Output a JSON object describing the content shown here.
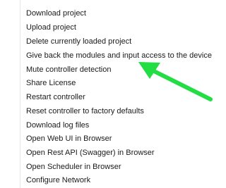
{
  "context_menu": {
    "items": [
      {
        "label": "Download project"
      },
      {
        "label": "Upload project"
      },
      {
        "label": "Delete currently loaded project"
      },
      {
        "label": "Give back the modules and input access to the device"
      },
      {
        "label": "Mute controller detection"
      },
      {
        "label": "Share License"
      },
      {
        "label": "Restart controller"
      },
      {
        "label": "Reset controller to factory defaults"
      },
      {
        "label": "Download log files"
      },
      {
        "label": "Open Web UI in Browser"
      },
      {
        "label": "Open Rest API (Swagger) in Browser"
      },
      {
        "label": "Open Scheduler in Browser"
      },
      {
        "label": "Configure Network"
      }
    ]
  },
  "annotation": {
    "arrow_color": "#22dd44"
  }
}
